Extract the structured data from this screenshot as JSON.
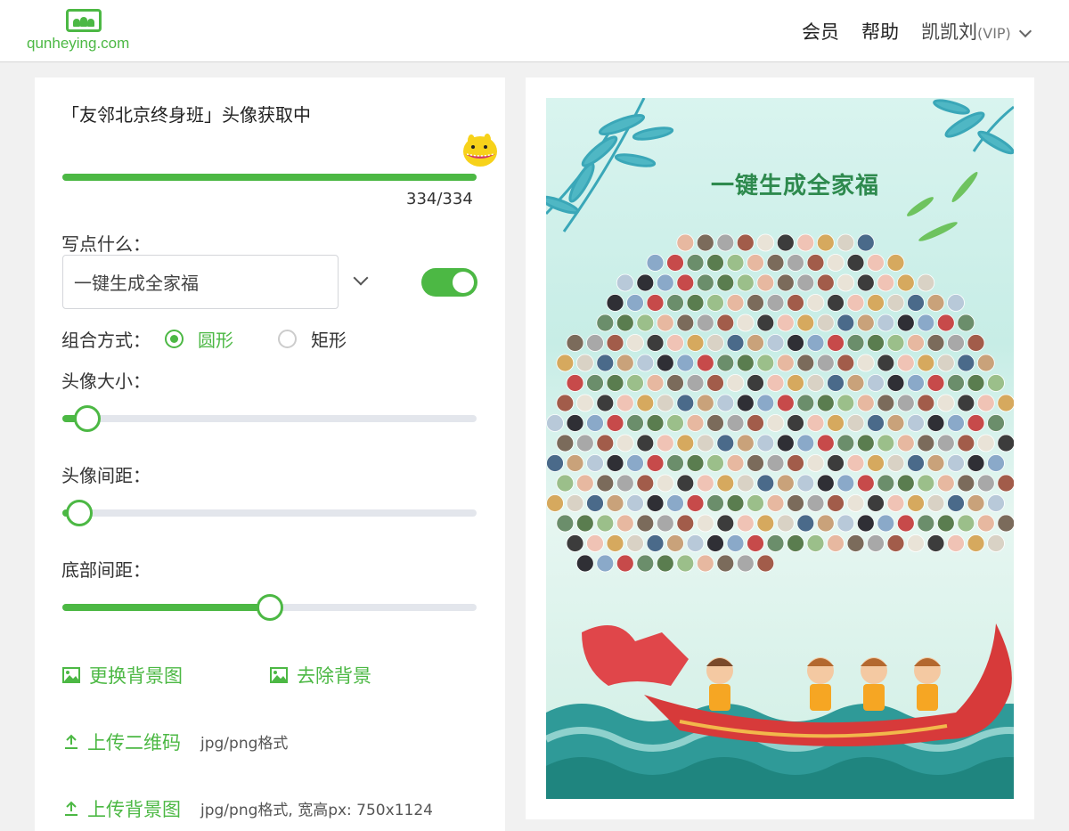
{
  "header": {
    "logo_text": "qunheying.com",
    "nav": {
      "member": "会员",
      "help": "帮助",
      "user": "凯凯刘",
      "user_badge": "(VIP)"
    }
  },
  "form": {
    "title": "「友邻北京终身班」头像获取中",
    "progress": {
      "done": 334,
      "total": 334,
      "label": "334/334"
    },
    "caption_label": "写点什么：",
    "caption_value": "一键生成全家福",
    "caption_toggle_on": true,
    "layout_label": "组合方式：",
    "layout_options": [
      "圆形",
      "矩形"
    ],
    "layout_selected": "圆形",
    "avatar_size_label": "头像大小：",
    "avatar_size_value": 0.06,
    "avatar_spacing_label": "头像间距：",
    "avatar_spacing_value": 0.04,
    "bottom_spacing_label": "底部间距：",
    "bottom_spacing_value": 0.5,
    "change_bg_label": "更换背景图",
    "remove_bg_label": "去除背景",
    "upload_qr_label": "上传二维码",
    "upload_qr_hint": "jpg/png格式",
    "upload_bg_label": "上传背景图",
    "upload_bg_hint": "jpg/png格式, 宽高px: 750x1124"
  },
  "poster": {
    "title": "一键生成全家福",
    "accent": "#4cb844",
    "avatar_count": 334
  }
}
